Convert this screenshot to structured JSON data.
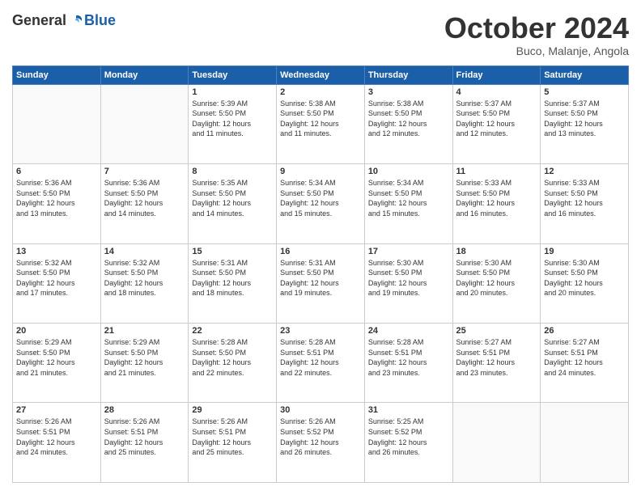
{
  "logo": {
    "general": "General",
    "blue": "Blue"
  },
  "title": "October 2024",
  "location": "Buco, Malanje, Angola",
  "days_of_week": [
    "Sunday",
    "Monday",
    "Tuesday",
    "Wednesday",
    "Thursday",
    "Friday",
    "Saturday"
  ],
  "weeks": [
    [
      {
        "day": "",
        "info": ""
      },
      {
        "day": "",
        "info": ""
      },
      {
        "day": "1",
        "info": "Sunrise: 5:39 AM\nSunset: 5:50 PM\nDaylight: 12 hours\nand 11 minutes."
      },
      {
        "day": "2",
        "info": "Sunrise: 5:38 AM\nSunset: 5:50 PM\nDaylight: 12 hours\nand 11 minutes."
      },
      {
        "day": "3",
        "info": "Sunrise: 5:38 AM\nSunset: 5:50 PM\nDaylight: 12 hours\nand 12 minutes."
      },
      {
        "day": "4",
        "info": "Sunrise: 5:37 AM\nSunset: 5:50 PM\nDaylight: 12 hours\nand 12 minutes."
      },
      {
        "day": "5",
        "info": "Sunrise: 5:37 AM\nSunset: 5:50 PM\nDaylight: 12 hours\nand 13 minutes."
      }
    ],
    [
      {
        "day": "6",
        "info": "Sunrise: 5:36 AM\nSunset: 5:50 PM\nDaylight: 12 hours\nand 13 minutes."
      },
      {
        "day": "7",
        "info": "Sunrise: 5:36 AM\nSunset: 5:50 PM\nDaylight: 12 hours\nand 14 minutes."
      },
      {
        "day": "8",
        "info": "Sunrise: 5:35 AM\nSunset: 5:50 PM\nDaylight: 12 hours\nand 14 minutes."
      },
      {
        "day": "9",
        "info": "Sunrise: 5:34 AM\nSunset: 5:50 PM\nDaylight: 12 hours\nand 15 minutes."
      },
      {
        "day": "10",
        "info": "Sunrise: 5:34 AM\nSunset: 5:50 PM\nDaylight: 12 hours\nand 15 minutes."
      },
      {
        "day": "11",
        "info": "Sunrise: 5:33 AM\nSunset: 5:50 PM\nDaylight: 12 hours\nand 16 minutes."
      },
      {
        "day": "12",
        "info": "Sunrise: 5:33 AM\nSunset: 5:50 PM\nDaylight: 12 hours\nand 16 minutes."
      }
    ],
    [
      {
        "day": "13",
        "info": "Sunrise: 5:32 AM\nSunset: 5:50 PM\nDaylight: 12 hours\nand 17 minutes."
      },
      {
        "day": "14",
        "info": "Sunrise: 5:32 AM\nSunset: 5:50 PM\nDaylight: 12 hours\nand 18 minutes."
      },
      {
        "day": "15",
        "info": "Sunrise: 5:31 AM\nSunset: 5:50 PM\nDaylight: 12 hours\nand 18 minutes."
      },
      {
        "day": "16",
        "info": "Sunrise: 5:31 AM\nSunset: 5:50 PM\nDaylight: 12 hours\nand 19 minutes."
      },
      {
        "day": "17",
        "info": "Sunrise: 5:30 AM\nSunset: 5:50 PM\nDaylight: 12 hours\nand 19 minutes."
      },
      {
        "day": "18",
        "info": "Sunrise: 5:30 AM\nSunset: 5:50 PM\nDaylight: 12 hours\nand 20 minutes."
      },
      {
        "day": "19",
        "info": "Sunrise: 5:30 AM\nSunset: 5:50 PM\nDaylight: 12 hours\nand 20 minutes."
      }
    ],
    [
      {
        "day": "20",
        "info": "Sunrise: 5:29 AM\nSunset: 5:50 PM\nDaylight: 12 hours\nand 21 minutes."
      },
      {
        "day": "21",
        "info": "Sunrise: 5:29 AM\nSunset: 5:50 PM\nDaylight: 12 hours\nand 21 minutes."
      },
      {
        "day": "22",
        "info": "Sunrise: 5:28 AM\nSunset: 5:50 PM\nDaylight: 12 hours\nand 22 minutes."
      },
      {
        "day": "23",
        "info": "Sunrise: 5:28 AM\nSunset: 5:51 PM\nDaylight: 12 hours\nand 22 minutes."
      },
      {
        "day": "24",
        "info": "Sunrise: 5:28 AM\nSunset: 5:51 PM\nDaylight: 12 hours\nand 23 minutes."
      },
      {
        "day": "25",
        "info": "Sunrise: 5:27 AM\nSunset: 5:51 PM\nDaylight: 12 hours\nand 23 minutes."
      },
      {
        "day": "26",
        "info": "Sunrise: 5:27 AM\nSunset: 5:51 PM\nDaylight: 12 hours\nand 24 minutes."
      }
    ],
    [
      {
        "day": "27",
        "info": "Sunrise: 5:26 AM\nSunset: 5:51 PM\nDaylight: 12 hours\nand 24 minutes."
      },
      {
        "day": "28",
        "info": "Sunrise: 5:26 AM\nSunset: 5:51 PM\nDaylight: 12 hours\nand 25 minutes."
      },
      {
        "day": "29",
        "info": "Sunrise: 5:26 AM\nSunset: 5:51 PM\nDaylight: 12 hours\nand 25 minutes."
      },
      {
        "day": "30",
        "info": "Sunrise: 5:26 AM\nSunset: 5:52 PM\nDaylight: 12 hours\nand 26 minutes."
      },
      {
        "day": "31",
        "info": "Sunrise: 5:25 AM\nSunset: 5:52 PM\nDaylight: 12 hours\nand 26 minutes."
      },
      {
        "day": "",
        "info": ""
      },
      {
        "day": "",
        "info": ""
      }
    ]
  ]
}
